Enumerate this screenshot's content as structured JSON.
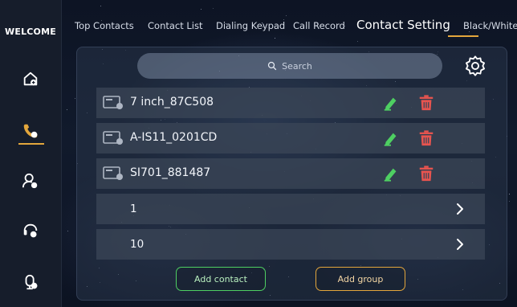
{
  "sidebar": {
    "title": "WELCOME",
    "items": [
      {
        "name": "home-icon"
      },
      {
        "name": "phone-icon",
        "active": true
      },
      {
        "name": "contact-settings-icon"
      },
      {
        "name": "call-monitor-icon"
      },
      {
        "name": "device-settings-icon"
      }
    ]
  },
  "tabs": [
    {
      "label": "Top Contacts"
    },
    {
      "label": "Contact List"
    },
    {
      "label": "Dialing Keypad"
    },
    {
      "label": "Call Record"
    },
    {
      "label": "Contact Setting",
      "active": true
    },
    {
      "label": "Black/White"
    }
  ],
  "search": {
    "placeholder": "Search"
  },
  "contacts": [
    {
      "name": "7 inch_87C508"
    },
    {
      "name": "A-IS11_0201CD"
    },
    {
      "name": "SI701_881487"
    }
  ],
  "groups": [
    {
      "name": "1"
    },
    {
      "name": "10"
    }
  ],
  "buttons": {
    "add_contact": "Add contact",
    "add_group": "Add group"
  },
  "colors": {
    "accent": "#e3a63c",
    "edit": "#4ecf62",
    "delete": "#e8544f",
    "add_contact_border": "#4ecf62",
    "add_group_border": "#e3a63c"
  }
}
